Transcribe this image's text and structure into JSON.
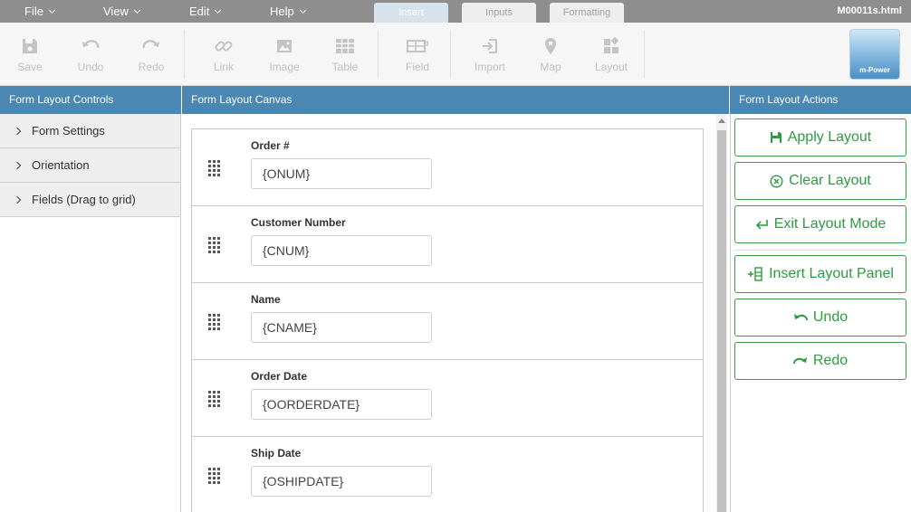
{
  "menu": {
    "file": "File",
    "view": "View",
    "edit": "Edit",
    "help": "Help"
  },
  "tabs": {
    "insert": "Insert",
    "inputs": "Inputs",
    "formatting": "Formatting"
  },
  "filename": "M00011s.html",
  "toolbar": {
    "save": "Save",
    "undo": "Undo",
    "redo": "Redo",
    "link": "Link",
    "image": "Image",
    "table": "Table",
    "field": "Field",
    "import": "Import",
    "map": "Map",
    "layout": "Layout"
  },
  "logo_text": "m-Power",
  "left_panel": {
    "title": "Form Layout Controls",
    "items": [
      "Form Settings",
      "Orientation",
      "Fields (Drag to grid)"
    ]
  },
  "canvas": {
    "title": "Form Layout Canvas",
    "fields": [
      {
        "label": "Order #",
        "value": "{ONUM}"
      },
      {
        "label": "Customer Number",
        "value": "{CNUM}"
      },
      {
        "label": "Name",
        "value": "{CNAME}"
      },
      {
        "label": "Order Date",
        "value": "{OORDERDATE}"
      },
      {
        "label": "Ship Date",
        "value": "{OSHIPDATE}"
      }
    ]
  },
  "right_panel": {
    "title": "Form Layout Actions",
    "apply": "Apply Layout",
    "clear": "Clear Layout",
    "exit": "Exit Layout Mode",
    "insert_panel": "Insert Layout Panel",
    "undo": "Undo",
    "redo": "Redo"
  },
  "colors": {
    "header_blue": "#4a87b2",
    "action_green": "#2e9a40",
    "menubar_gray": "#8e8e8e"
  }
}
